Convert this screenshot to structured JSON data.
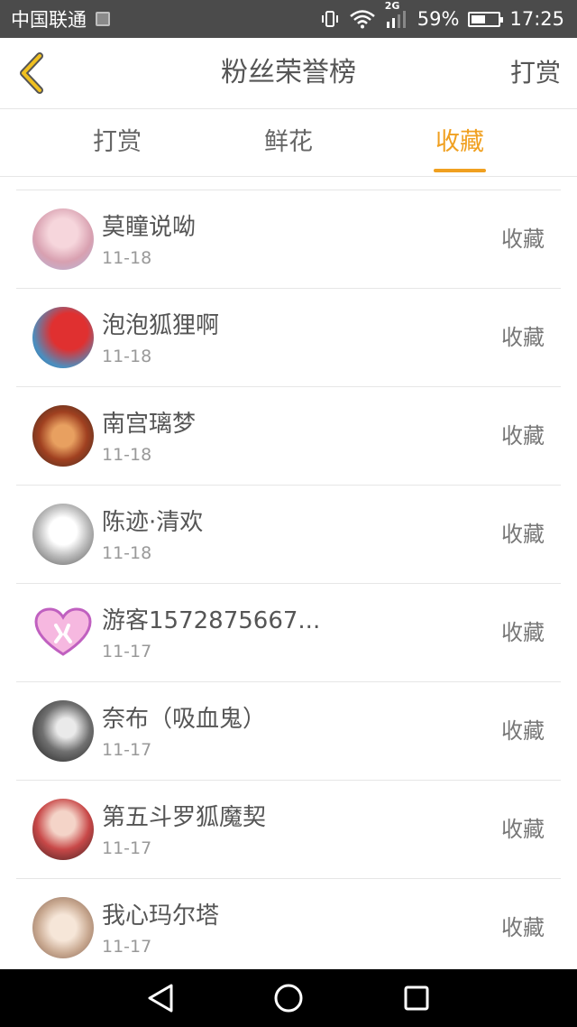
{
  "status_bar": {
    "carrier": "中国联通",
    "network": "2G",
    "battery": "59%",
    "time": "17:25",
    "battery_level": 0.59
  },
  "header": {
    "title": "粉丝荣誉榜",
    "action": "打赏",
    "back_icon": "chevron-left-icon",
    "accent_color": "#f0a020"
  },
  "tabs": [
    {
      "label": "打赏",
      "active": false
    },
    {
      "label": "鲜花",
      "active": false
    },
    {
      "label": "收藏",
      "active": true
    }
  ],
  "fans": [
    {
      "name": "莫瞳说呦",
      "date": "11-18",
      "action": "收藏"
    },
    {
      "name": "泡泡狐狸啊",
      "date": "11-18",
      "action": "收藏"
    },
    {
      "name": "南宫璃梦",
      "date": "11-18",
      "action": "收藏"
    },
    {
      "name": "陈迹·清欢",
      "date": "11-18",
      "action": "收藏"
    },
    {
      "name": "游客1572875667...",
      "date": "11-17",
      "action": "收藏"
    },
    {
      "name": "奈布（吸血鬼）",
      "date": "11-17",
      "action": "收藏"
    },
    {
      "name": "第五斗罗狐魔契",
      "date": "11-17",
      "action": "收藏"
    },
    {
      "name": "我心玛尔塔",
      "date": "11-17",
      "action": "收藏"
    }
  ],
  "nav_bar": {
    "back_icon": "triangle-back-icon",
    "home_icon": "circle-home-icon",
    "recents_icon": "square-recents-icon"
  }
}
